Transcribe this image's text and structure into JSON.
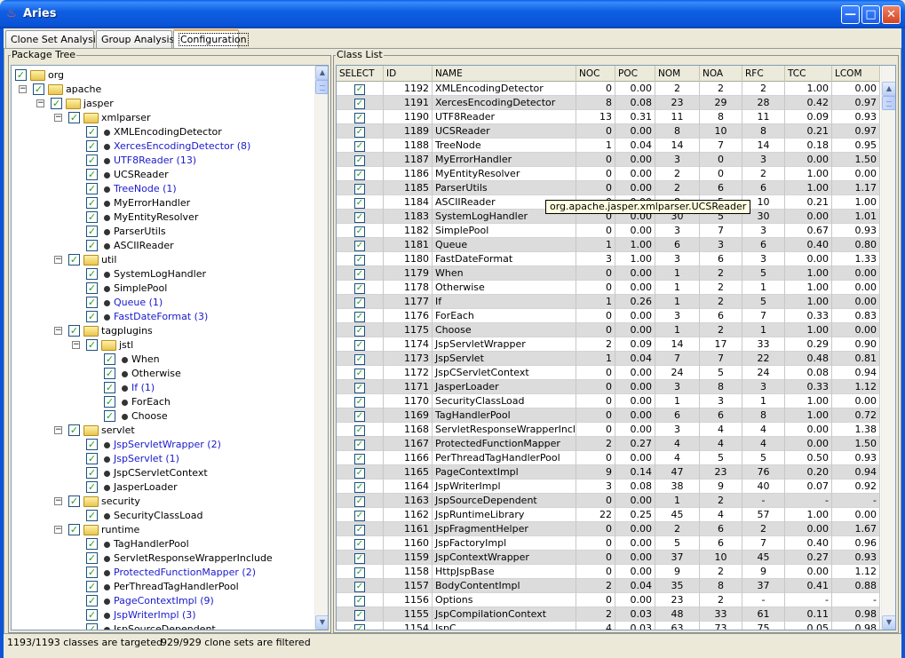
{
  "window": {
    "title": "Aries",
    "app_icon_glyph": "♨",
    "minimize_glyph": "—",
    "maximize_glyph": "□",
    "close_glyph": "✕"
  },
  "tabs": [
    {
      "label": "Clone Set Analysis",
      "active": false
    },
    {
      "label": "Group Analysis",
      "active": false
    },
    {
      "label": "Configuration",
      "active": true
    }
  ],
  "package_tree": {
    "legend": "Package Tree",
    "nodes": [
      {
        "level": 0,
        "type": "pkg",
        "expander": "",
        "label": "org"
      },
      {
        "level": 1,
        "type": "pkg",
        "expander": "−",
        "label": "apache"
      },
      {
        "level": 2,
        "type": "pkg",
        "expander": "−",
        "label": "jasper"
      },
      {
        "level": 3,
        "type": "pkg",
        "expander": "−",
        "label": "xmlparser"
      },
      {
        "level": 4,
        "type": "cls",
        "label": "XMLEncodingDetector",
        "highlight": false
      },
      {
        "level": 4,
        "type": "cls",
        "label": "XercesEncodingDetector (8)",
        "highlight": true
      },
      {
        "level": 4,
        "type": "cls",
        "label": "UTF8Reader (13)",
        "highlight": true
      },
      {
        "level": 4,
        "type": "cls",
        "label": "UCSReader",
        "highlight": false
      },
      {
        "level": 4,
        "type": "cls",
        "label": "TreeNode (1)",
        "highlight": true
      },
      {
        "level": 4,
        "type": "cls",
        "label": "MyErrorHandler",
        "highlight": false
      },
      {
        "level": 4,
        "type": "cls",
        "label": "MyEntityResolver",
        "highlight": false
      },
      {
        "level": 4,
        "type": "cls",
        "label": "ParserUtils",
        "highlight": false
      },
      {
        "level": 4,
        "type": "cls",
        "label": "ASCIIReader",
        "highlight": false
      },
      {
        "level": 3,
        "type": "pkg",
        "expander": "−",
        "label": "util"
      },
      {
        "level": 4,
        "type": "cls",
        "label": "SystemLogHandler",
        "highlight": false
      },
      {
        "level": 4,
        "type": "cls",
        "label": "SimplePool",
        "highlight": false
      },
      {
        "level": 4,
        "type": "cls",
        "label": "Queue (1)",
        "highlight": true
      },
      {
        "level": 4,
        "type": "cls",
        "label": "FastDateFormat (3)",
        "highlight": true
      },
      {
        "level": 3,
        "type": "pkg",
        "expander": "−",
        "label": "tagplugins"
      },
      {
        "level": 4,
        "type": "pkg",
        "expander": "−",
        "label": "jstl"
      },
      {
        "level": 5,
        "type": "cls",
        "label": "When",
        "highlight": false
      },
      {
        "level": 5,
        "type": "cls",
        "label": "Otherwise",
        "highlight": false
      },
      {
        "level": 5,
        "type": "cls",
        "label": "If (1)",
        "highlight": true
      },
      {
        "level": 5,
        "type": "cls",
        "label": "ForEach",
        "highlight": false
      },
      {
        "level": 5,
        "type": "cls",
        "label": "Choose",
        "highlight": false
      },
      {
        "level": 3,
        "type": "pkg",
        "expander": "−",
        "label": "servlet"
      },
      {
        "level": 4,
        "type": "cls",
        "label": "JspServletWrapper (2)",
        "highlight": true
      },
      {
        "level": 4,
        "type": "cls",
        "label": "JspServlet (1)",
        "highlight": true
      },
      {
        "level": 4,
        "type": "cls",
        "label": "JspCServletContext",
        "highlight": false
      },
      {
        "level": 4,
        "type": "cls",
        "label": "JasperLoader",
        "highlight": false
      },
      {
        "level": 3,
        "type": "pkg",
        "expander": "−",
        "label": "security"
      },
      {
        "level": 4,
        "type": "cls",
        "label": "SecurityClassLoad",
        "highlight": false
      },
      {
        "level": 3,
        "type": "pkg",
        "expander": "−",
        "label": "runtime"
      },
      {
        "level": 4,
        "type": "cls",
        "label": "TagHandlerPool",
        "highlight": false
      },
      {
        "level": 4,
        "type": "cls",
        "label": "ServletResponseWrapperInclude",
        "highlight": false
      },
      {
        "level": 4,
        "type": "cls",
        "label": "ProtectedFunctionMapper (2)",
        "highlight": true
      },
      {
        "level": 4,
        "type": "cls",
        "label": "PerThreadTagHandlerPool",
        "highlight": false
      },
      {
        "level": 4,
        "type": "cls",
        "label": "PageContextImpl (9)",
        "highlight": true
      },
      {
        "level": 4,
        "type": "cls",
        "label": "JspWriterImpl (3)",
        "highlight": true
      },
      {
        "level": 4,
        "type": "cls",
        "label": "JspSourceDependent",
        "highlight": false
      }
    ]
  },
  "class_list": {
    "legend": "Class List",
    "columns": [
      "SELECT",
      "ID",
      "NAME",
      "NOC",
      "POC",
      "NOM",
      "NOA",
      "RFC",
      "TCC",
      "LCOM"
    ],
    "rows": [
      [
        "1192",
        "XMLEncodingDetector",
        "0",
        "0.00",
        "2",
        "2",
        "2",
        "1.00",
        "0.00"
      ],
      [
        "1191",
        "XercesEncodingDetector",
        "8",
        "0.08",
        "23",
        "29",
        "28",
        "0.42",
        "0.97"
      ],
      [
        "1190",
        "UTF8Reader",
        "13",
        "0.31",
        "11",
        "8",
        "11",
        "0.09",
        "0.93"
      ],
      [
        "1189",
        "UCSReader",
        "0",
        "0.00",
        "8",
        "10",
        "8",
        "0.21",
        "0.97"
      ],
      [
        "1188",
        "TreeNode",
        "1",
        "0.04",
        "14",
        "7",
        "14",
        "0.18",
        "0.95"
      ],
      [
        "1187",
        "MyErrorHandler",
        "0",
        "0.00",
        "3",
        "0",
        "3",
        "0.00",
        "1.50"
      ],
      [
        "1186",
        "MyEntityResolver",
        "0",
        "0.00",
        "2",
        "0",
        "2",
        "1.00",
        "0.00"
      ],
      [
        "1185",
        "ParserUtils",
        "0",
        "0.00",
        "2",
        "6",
        "6",
        "1.00",
        "1.17"
      ],
      [
        "1184",
        "ASCIIReader",
        "0",
        "0.00",
        "8",
        "5",
        "10",
        "0.21",
        "1.00"
      ],
      [
        "1183",
        "SystemLogHandler",
        "0",
        "0.00",
        "30",
        "5",
        "30",
        "0.00",
        "1.01"
      ],
      [
        "1182",
        "SimplePool",
        "0",
        "0.00",
        "3",
        "7",
        "3",
        "0.67",
        "0.93"
      ],
      [
        "1181",
        "Queue",
        "1",
        "1.00",
        "6",
        "3",
        "6",
        "0.40",
        "0.80"
      ],
      [
        "1180",
        "FastDateFormat",
        "3",
        "1.00",
        "3",
        "6",
        "3",
        "0.00",
        "1.33"
      ],
      [
        "1179",
        "When",
        "0",
        "0.00",
        "1",
        "2",
        "5",
        "1.00",
        "0.00"
      ],
      [
        "1178",
        "Otherwise",
        "0",
        "0.00",
        "1",
        "2",
        "1",
        "1.00",
        "0.00"
      ],
      [
        "1177",
        "If",
        "1",
        "0.26",
        "1",
        "2",
        "5",
        "1.00",
        "0.00"
      ],
      [
        "1176",
        "ForEach",
        "0",
        "0.00",
        "3",
        "6",
        "7",
        "0.33",
        "0.83"
      ],
      [
        "1175",
        "Choose",
        "0",
        "0.00",
        "1",
        "2",
        "1",
        "1.00",
        "0.00"
      ],
      [
        "1174",
        "JspServletWrapper",
        "2",
        "0.09",
        "14",
        "17",
        "33",
        "0.29",
        "0.90"
      ],
      [
        "1173",
        "JspServlet",
        "1",
        "0.04",
        "7",
        "7",
        "22",
        "0.48",
        "0.81"
      ],
      [
        "1172",
        "JspCServletContext",
        "0",
        "0.00",
        "24",
        "5",
        "24",
        "0.08",
        "0.94"
      ],
      [
        "1171",
        "JasperLoader",
        "0",
        "0.00",
        "3",
        "8",
        "3",
        "0.33",
        "1.12"
      ],
      [
        "1170",
        "SecurityClassLoad",
        "0",
        "0.00",
        "1",
        "3",
        "1",
        "1.00",
        "0.00"
      ],
      [
        "1169",
        "TagHandlerPool",
        "0",
        "0.00",
        "6",
        "6",
        "8",
        "1.00",
        "0.72"
      ],
      [
        "1168",
        "ServletResponseWrapperInclude",
        "0",
        "0.00",
        "3",
        "4",
        "4",
        "0.00",
        "1.38"
      ],
      [
        "1167",
        "ProtectedFunctionMapper",
        "2",
        "0.27",
        "4",
        "4",
        "4",
        "0.00",
        "1.50"
      ],
      [
        "1166",
        "PerThreadTagHandlerPool",
        "0",
        "0.00",
        "4",
        "5",
        "5",
        "0.50",
        "0.93"
      ],
      [
        "1165",
        "PageContextImpl",
        "9",
        "0.14",
        "47",
        "23",
        "76",
        "0.20",
        "0.94"
      ],
      [
        "1164",
        "JspWriterImpl",
        "3",
        "0.08",
        "38",
        "9",
        "40",
        "0.07",
        "0.92"
      ],
      [
        "1163",
        "JspSourceDependent",
        "0",
        "0.00",
        "1",
        "2",
        "-",
        "-",
        "-"
      ],
      [
        "1162",
        "JspRuntimeLibrary",
        "22",
        "0.25",
        "45",
        "4",
        "57",
        "1.00",
        "0.00"
      ],
      [
        "1161",
        "JspFragmentHelper",
        "0",
        "0.00",
        "2",
        "6",
        "2",
        "0.00",
        "1.67"
      ],
      [
        "1160",
        "JspFactoryImpl",
        "0",
        "0.00",
        "5",
        "6",
        "7",
        "0.40",
        "0.96"
      ],
      [
        "1159",
        "JspContextWrapper",
        "0",
        "0.00",
        "37",
        "10",
        "45",
        "0.27",
        "0.93"
      ],
      [
        "1158",
        "HttpJspBase",
        "0",
        "0.00",
        "9",
        "2",
        "9",
        "0.00",
        "1.12"
      ],
      [
        "1157",
        "BodyContentImpl",
        "2",
        "0.04",
        "35",
        "8",
        "37",
        "0.41",
        "0.88"
      ],
      [
        "1156",
        "Options",
        "0",
        "0.00",
        "23",
        "2",
        "-",
        "-",
        "-"
      ],
      [
        "1155",
        "JspCompilationContext",
        "2",
        "0.03",
        "48",
        "33",
        "61",
        "0.11",
        "0.98"
      ],
      [
        "1154",
        "JspC",
        "4",
        "0.03",
        "63",
        "73",
        "75",
        "0.05",
        "0.98"
      ]
    ],
    "tooltip": "org.apache.jasper.xmlparser.UCSReader"
  },
  "status": {
    "classes_targeted": "1193/1193 classes are targeted",
    "clone_sets_filtered": "929/929 clone sets are filtered"
  },
  "check_glyph": "✓",
  "colors": {
    "titlebar": "#0a53d6",
    "highlight_text": "#1a1acc",
    "checkbox_check": "#21a121",
    "alt_row": "#dcdcdc",
    "tooltip_bg": "#ffffe1"
  },
  "icons": {
    "app": "java-cup-icon",
    "tree_checkbox": "checkbox-checked-icon",
    "package": "folder-icon",
    "class": "class-bullet-icon",
    "expander": "minus-box-icon"
  }
}
